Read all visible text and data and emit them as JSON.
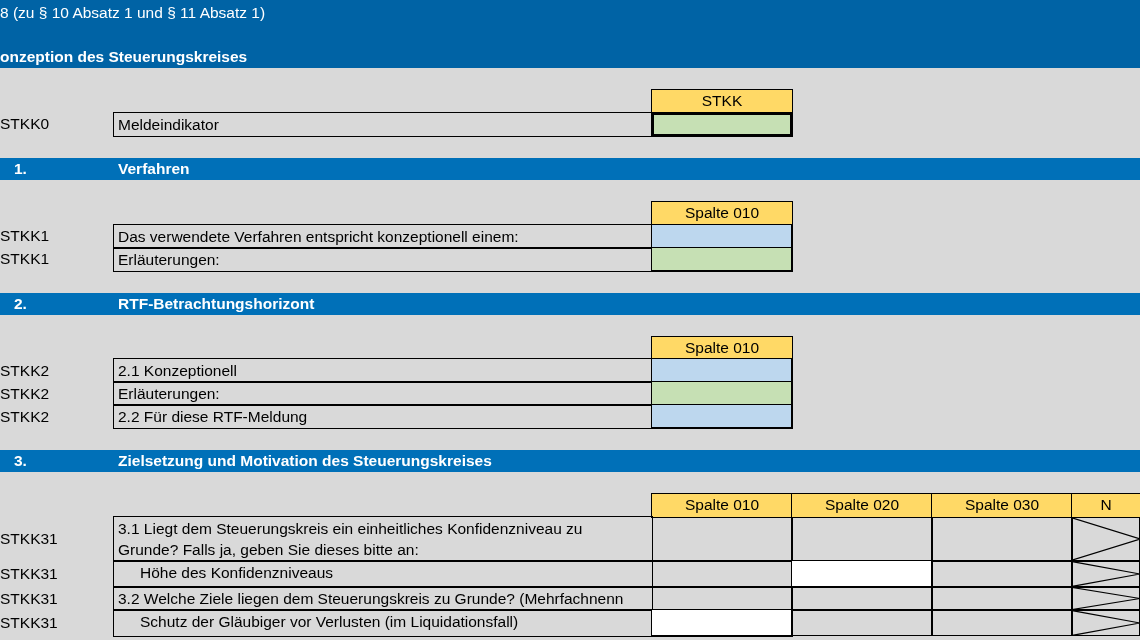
{
  "title_bar": {
    "subtitle": "8 (zu § 10 Absatz 1 und § 11 Absatz 1)",
    "heading": "onzeption des Steuerungskreises"
  },
  "blocks": [
    {
      "columns": [
        "STKK"
      ],
      "rows": [
        {
          "code": "STKK0",
          "label": "Meldeindikator",
          "sub": false,
          "cells": [
            {
              "kind": "text",
              "selected": true
            }
          ]
        }
      ]
    },
    {
      "number": "1.",
      "title": "Verfahren",
      "columns": [
        "Spalte 010"
      ],
      "rows": [
        {
          "code": "STKK1",
          "label": "Das verwendete Verfahren entspricht konzeptionell einem:",
          "sub": false,
          "cells": [
            {
              "kind": "select",
              "selected": false
            }
          ]
        },
        {
          "code": "STKK1",
          "label": "Erläuterungen:",
          "sub": false,
          "cells": [
            {
              "kind": "text",
              "selected": false
            }
          ]
        }
      ]
    },
    {
      "number": "2.",
      "title": "RTF-Betrachtungshorizont",
      "columns": [
        "Spalte 010"
      ],
      "rows": [
        {
          "code": "STKK2",
          "label": "2.1 Konzeptionell",
          "sub": false,
          "cells": [
            {
              "kind": "select",
              "selected": false
            }
          ]
        },
        {
          "code": "STKK2",
          "label": "Erläuterungen:",
          "sub": false,
          "cells": [
            {
              "kind": "text",
              "selected": false
            }
          ]
        },
        {
          "code": "STKK2",
          "label": "2.2 Für diese RTF-Meldung",
          "sub": false,
          "cells": [
            {
              "kind": "select",
              "selected": false
            }
          ]
        }
      ]
    },
    {
      "number": "3.",
      "title": "Zielsetzung und Motivation des Steuerungskreises",
      "columns": [
        "Spalte 010",
        "Spalte 020",
        "Spalte 030",
        "N"
      ],
      "rows": [
        {
          "code": "STKK31",
          "label": "3.1 Liegt dem Steuerungskreis ein einheitliches Konfidenzniveau zu\nGrunde? Falls ja, geben Sie dieses bitte an:",
          "sub": false,
          "cells": [
            {
              "kind": "blank"
            },
            {
              "kind": "blank"
            },
            {
              "kind": "blank"
            },
            {
              "kind": "na"
            }
          ]
        },
        {
          "code": "STKK31",
          "label": "Höhe des Konfidenzniveaus",
          "sub": true,
          "cells": [
            {
              "kind": "blank"
            },
            {
              "kind": "number",
              "selected": false
            },
            {
              "kind": "blank"
            },
            {
              "kind": "na"
            }
          ]
        },
        {
          "code": "STKK31",
          "label": "3.2 Welche Ziele liegen dem Steuerungskreis zu Grunde? (Mehrfachnenn",
          "sub": false,
          "cells": [
            {
              "kind": "blank"
            },
            {
              "kind": "blank"
            },
            {
              "kind": "blank"
            },
            {
              "kind": "na"
            }
          ]
        },
        {
          "code": "STKK31",
          "label": "Schutz der Gläubiger vor Verlusten (im Liquidationsfall)",
          "sub": true,
          "cells": [
            {
              "kind": "number",
              "selected": false
            },
            {
              "kind": "blank"
            },
            {
              "kind": "blank"
            },
            {
              "kind": "na"
            }
          ]
        }
      ]
    }
  ]
}
